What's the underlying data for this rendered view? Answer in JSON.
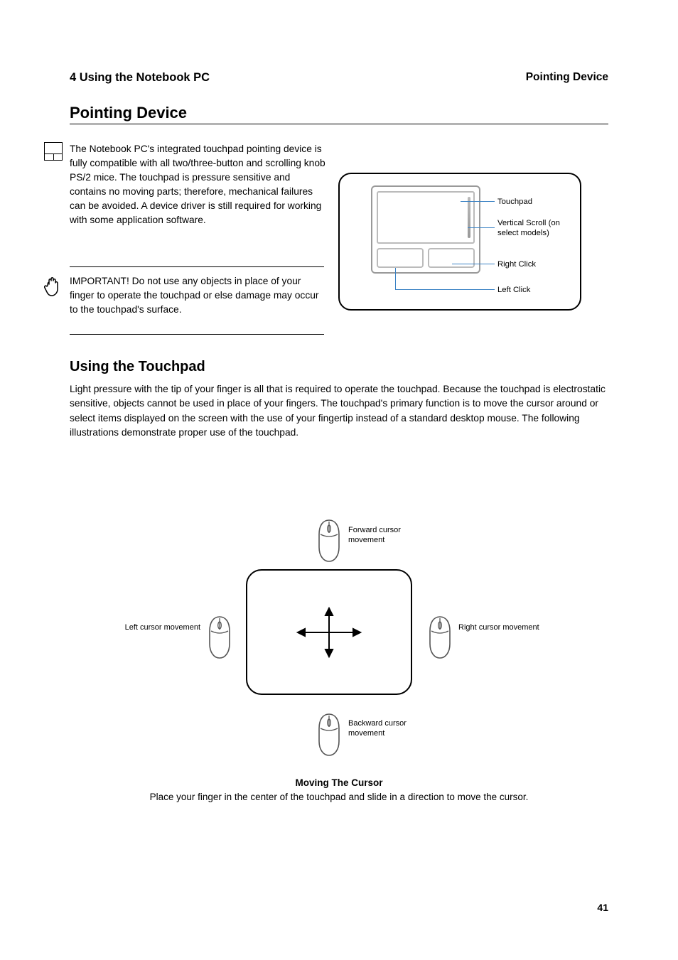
{
  "header": {
    "chapter": "4    Using the Notebook PC",
    "breadcrumb": "Pointing Device"
  },
  "section_heading": "Pointing Device",
  "note1": "The Notebook PC's integrated touchpad pointing device is fully compatible with all two/three-button and scrolling knob PS/2 mice. The touchpad is pressure sensitive and contains no moving parts; therefore, mechanical failures can be avoided. A device driver is still required for working with some application software.",
  "note2": "IMPORTANT! Do not use any objects in place of your finger to operate the touchpad or else damage may occur to the touchpad's surface.",
  "diagram": {
    "labels": {
      "touchpad": "Touchpad",
      "vscroll": "Vertical Scroll (on select models)",
      "right": "Right Click",
      "left": "Left Click"
    }
  },
  "subheading": "Using the Touchpad",
  "body": "Light pressure with the tip of your finger is all that is required to operate the touchpad. Because the touchpad is electrostatic sensitive, objects cannot be used in place of your fingers. The touchpad's primary function is to move the cursor around or select items displayed on the screen with the use of your fingertip instead of a standard desktop mouse. The following illustrations demonstrate proper use of the touchpad.",
  "cursor_labels": {
    "top": "Forward cursor movement",
    "bottom": "Backward cursor movement",
    "left": "Left cursor movement",
    "right": "Right cursor movement"
  },
  "caption": {
    "title": "Moving The Cursor",
    "text": "Place your finger in the center of the touchpad and slide in a direction to move the cursor."
  },
  "page_number": "41"
}
